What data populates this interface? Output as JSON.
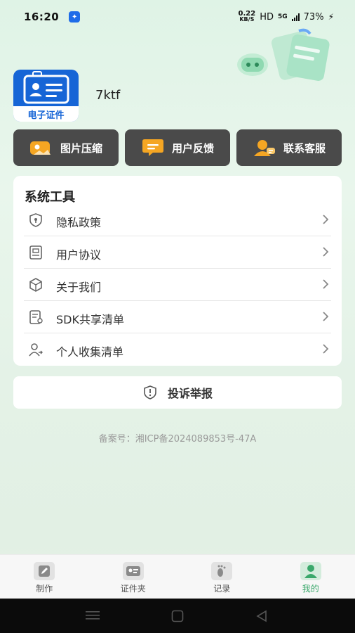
{
  "status": {
    "time": "16:20",
    "net_speed": "0.22",
    "net_unit": "KB/S",
    "hd": "HD",
    "network": "5G",
    "battery": "73%"
  },
  "profile": {
    "logo_label": "电子证件",
    "username": "7ktf"
  },
  "quick_actions": [
    {
      "label": "图片压缩",
      "icon": "image-compress-icon"
    },
    {
      "label": "用户反馈",
      "icon": "feedback-icon"
    },
    {
      "label": "联系客服",
      "icon": "customer-service-icon"
    }
  ],
  "tools": {
    "title": "系统工具",
    "items": [
      {
        "label": "隐私政策",
        "icon": "shield-icon"
      },
      {
        "label": "用户协议",
        "icon": "document-icon"
      },
      {
        "label": "关于我们",
        "icon": "cube-icon"
      },
      {
        "label": "SDK共享清单",
        "icon": "list-icon"
      },
      {
        "label": "个人收集清单",
        "icon": "user-share-icon"
      }
    ]
  },
  "complaint": {
    "label": "投诉举报",
    "icon": "alert-shield-icon"
  },
  "icp": "备案号：湘ICP备2024089853号-47A",
  "tabs": [
    {
      "label": "制作",
      "icon": "edit-icon",
      "active": false
    },
    {
      "label": "证件夹",
      "icon": "id-card-icon",
      "active": false
    },
    {
      "label": "记录",
      "icon": "footprint-icon",
      "active": false
    },
    {
      "label": "我的",
      "icon": "person-icon",
      "active": true
    }
  ],
  "colors": {
    "accent": "#3aa86b",
    "quick_button_bg": "#4a4a4a",
    "logo_blue": "#1665d6",
    "quick_icon_orange": "#f5a623"
  }
}
